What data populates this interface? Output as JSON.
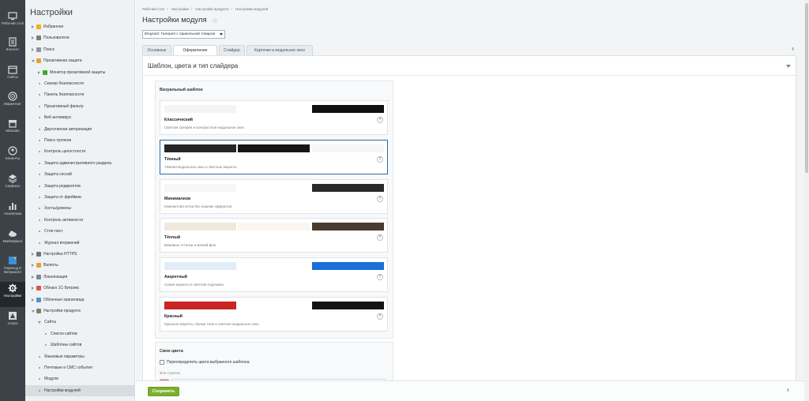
{
  "rail": [
    {
      "label": "Рабочий стол",
      "icon": "desktop-icon"
    },
    {
      "label": "Контент",
      "icon": "document-icon"
    },
    {
      "label": "Сайты",
      "icon": "calendar-icon"
    },
    {
      "label": "Маркетинг",
      "icon": "target-icon"
    },
    {
      "label": "Магазин",
      "icon": "store-icon"
    },
    {
      "label": "Клиенты",
      "icon": "clients-icon"
    },
    {
      "label": "Сервисы",
      "icon": "layers-icon"
    },
    {
      "label": "Аналитика",
      "icon": "bar-chart-icon"
    },
    {
      "label": "Marketplace",
      "icon": "cloud-icon"
    },
    {
      "label": "Переход в Битрикс24",
      "icon": "bitrix24-icon"
    },
    {
      "label": "Настройки",
      "icon": "gear-icon"
    },
    {
      "label": "Аспро",
      "icon": "aspro-icon"
    }
  ],
  "sidebar": {
    "title": "Настройки",
    "items": [
      {
        "label": "Избранное",
        "icon_color": "#f0b21b"
      },
      {
        "label": "Пользователи",
        "icon_color": "#8a7a6a"
      },
      {
        "label": "Поиск",
        "icon_color": "#8d969b"
      },
      {
        "label": "Проактивная защита",
        "icon_color": "#e2a23a"
      },
      {
        "label": "Монитор проактивной защиты",
        "icon_color": "#3daa2e"
      },
      {
        "label": "Сканер безопасности"
      },
      {
        "label": "Панель безопасности"
      },
      {
        "label": "Проактивный фильтр"
      },
      {
        "label": "Веб-антивирус"
      },
      {
        "label": "Двухэтапная авторизация"
      },
      {
        "label": "Поиск троянов"
      },
      {
        "label": "Контроль целостности"
      },
      {
        "label": "Защита административного раздела"
      },
      {
        "label": "Защита сессий"
      },
      {
        "label": "Защита редиректов"
      },
      {
        "label": "Защита от фреймов"
      },
      {
        "label": "Хосты/домены"
      },
      {
        "label": "Контроль активности"
      },
      {
        "label": "Стоп-лист"
      },
      {
        "label": "Журнал вторжений"
      },
      {
        "label": "Настройка HTTPS",
        "icon_color": "#6b747a"
      },
      {
        "label": "Валюты",
        "icon_color": "#e2a23a"
      },
      {
        "label": "Локализация",
        "icon_color": "#7a8a95"
      },
      {
        "label": "Облако 1С-Битрикс",
        "icon_color": "#d9593c"
      },
      {
        "label": "Облачные хранилища",
        "icon_color": "#5a8fc4"
      },
      {
        "label": "Настройки продукта",
        "icon_color": "#8a7a6a"
      },
      {
        "label": "Сайты"
      },
      {
        "label": "Список сайтов"
      },
      {
        "label": "Шаблоны сайтов"
      },
      {
        "label": "Языковые параметры"
      },
      {
        "label": "Почтовые и СМС события"
      },
      {
        "label": "Модули"
      },
      {
        "label": "Настройки модулей"
      }
    ]
  },
  "breadcrumb": [
    "Рабочий стол",
    "Настройки",
    "Настройки продукта",
    "Настройки модулей"
  ],
  "page_title": "Настройки модуля",
  "module_select_value": "Elegrant: Галерея с прикольной товаров",
  "tabs": [
    "Основные",
    "Оформление",
    "Слайдер",
    "Карточки и модальное окно"
  ],
  "section_title": "Шаблон, цвета и тип слайдера",
  "templates_heading": "Визуальный шаблон",
  "templates": [
    {
      "name": "Классический",
      "desc": "Светлая галерея и контрастное модальное окно",
      "colors": [
        "#f4f4f4",
        "#ffffff",
        "#111111"
      ]
    },
    {
      "name": "Тёмный",
      "desc": "Тёмная модальное окно и светлые акценты",
      "colors": [
        "#262626",
        "#161616",
        "#f6f6f6"
      ]
    },
    {
      "name": "Минимализм",
      "desc": "Компактная сетка без лишних эффектов",
      "colors": [
        "#f6f6f6",
        "#ffffff",
        "#2a2a2a"
      ]
    },
    {
      "name": "Тёплый",
      "desc": "Бежевые оттенки и мягкий фон",
      "colors": [
        "#f1e8dc",
        "#faf6f0",
        "#4b3a2e"
      ]
    },
    {
      "name": "Акцентный",
      "desc": "Синие акценты и светлая подложка",
      "colors": [
        "#e3edf8",
        "#ffffff",
        "#1a6fd8"
      ]
    },
    {
      "name": "Красный",
      "desc": "Красные акценты, белые тони и светлое модальное окно",
      "colors": [
        "#c92525",
        "#ffffff",
        "#141414"
      ]
    }
  ],
  "help_glyph": "?",
  "own_colors": {
    "heading": "Свои цвета",
    "checkbox_label": "Переопределить цвета выбранного шаблона",
    "field_label": "Фон стрелок",
    "swatch_color": "#cf7a7e"
  },
  "save_label": "Сохранить",
  "pin_glyph": "⇟",
  "star_glyph": "☆"
}
